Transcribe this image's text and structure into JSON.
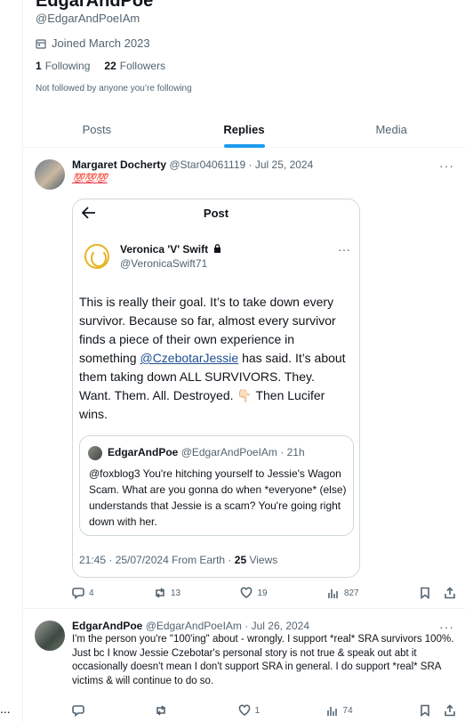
{
  "profile": {
    "display_name": "EdgarAndPoe",
    "handle": "@EdgarAndPoeIAm",
    "joined": "Joined March 2023",
    "following_count": "1",
    "following_label": "Following",
    "followers_count": "22",
    "followers_label": "Followers",
    "not_followed": "Not followed by anyone you’re following"
  },
  "tabs": [
    {
      "label": "Posts",
      "active": false
    },
    {
      "label": "Replies",
      "active": true
    },
    {
      "label": "Media",
      "active": false
    }
  ],
  "tweets": [
    {
      "author": "Margaret Docherty",
      "handle": "@Star04061119",
      "sep": "·",
      "date": "Jul 25, 2024",
      "text": "💯💯💯",
      "embedded": {
        "header_title": "Post",
        "author": "Veronica 'V' Swift",
        "handle": "@VeronicaSwift71",
        "text_part1": "This is really their goal.  It’s to take down every survivor.  Because so far, almost every survivor finds a piece of their own experience in something ",
        "mention": "@CzebotarJessie",
        "text_part2": " has said.  It’s about them taking down ALL SURVIVORS. They. Want. Them. All. Destroyed.  👇🏻  Then Lucifer wins.",
        "quote": {
          "author": "EdgarAndPoe",
          "handle": "@EdgarAndPoeIAm",
          "age": "· 21h",
          "text": "@foxblog3  You're hitching yourself to Jessie's Wagon Scam.  What are you gonna do when *everyone* (else) understands that Jessie is a scam?  You're going right down with her."
        },
        "timestamp": "21:45 · 25/07/2024 From Earth · ",
        "views_count": "25",
        "views_label": " Views"
      },
      "actions": {
        "replies": "4",
        "reposts": "13",
        "likes": "19",
        "views": "827"
      }
    },
    {
      "author": "EdgarAndPoe",
      "handle": "@EdgarAndPoeIAm",
      "sep": "·",
      "date": "Jul 26, 2024",
      "text": "I'm the person you're \"100'ing\" about - wrongly. I support *real* SRA survivors 100%. Just bc I know Jessie Czebotar's personal story is not true & speak out abt it occasionally doesn't mean I don't support SRA in general. I do support *real* SRA victims & will continue to do so.",
      "actions": {
        "replies": "",
        "reposts": "",
        "likes": "1",
        "views": "74"
      }
    }
  ],
  "left_dots": "...",
  "more_icon": "···"
}
